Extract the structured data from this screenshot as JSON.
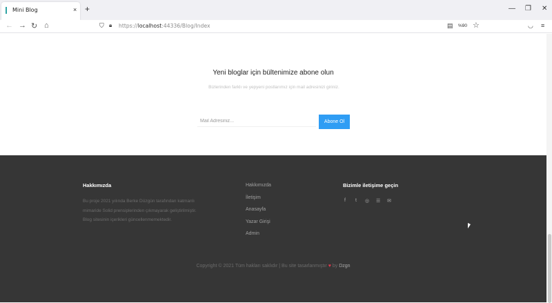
{
  "browser": {
    "tab_title": "Mini Blog",
    "tab_close": "×",
    "new_tab": "+",
    "minimize": "—",
    "restore": "❐",
    "close": "✕",
    "back": "←",
    "forward": "→",
    "reload": "↻",
    "home": "⌂",
    "url_scheme": "https://",
    "url_host": "localhost",
    "url_rest": ":44336/Blog/Index",
    "zoom": "%90",
    "star": "☆",
    "pocket": "◡",
    "menu": "≡"
  },
  "newsletter": {
    "title": "Yeni bloglar için bültenimize abone olun",
    "description": "Bizlerinden farklı ve yepyeni postlarımız için mail adresinizi giriniz.",
    "email_placeholder": "Mail Adresiniz...",
    "subscribe_label": "Abone Ol"
  },
  "footer": {
    "about_heading": "Hakkımızda",
    "about_text": "Bu proje 2021 yılında Berke Düzgün tarafından katmanlı mimaride Solid prensiplerinden çıkmayarak geliştirilmiştir. Blog sitesinin içerikleri güncellenmemektedir.",
    "links": [
      "Hakkımızda",
      "İletişim",
      "Anasayfa",
      "Yazar Girişi",
      "Admin"
    ],
    "contact_heading": "Bizimle iletişime geçin",
    "social": [
      "f",
      "t",
      "◎",
      "☰",
      "✉"
    ],
    "copyright": "Copyright © 2021 Tüm hakları saklıdır | Bu site tasarlanmıştır",
    "heart": "♥",
    "by": "by",
    "author": "Dzgn"
  }
}
